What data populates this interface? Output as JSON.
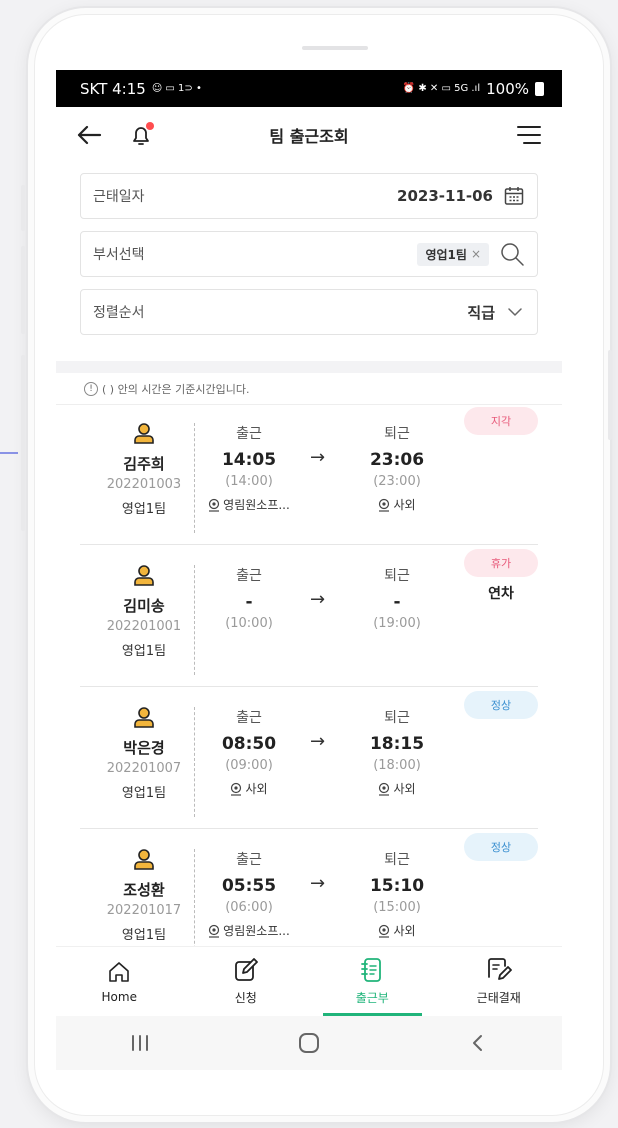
{
  "statusbar": {
    "carrier_time": "SKT 4:15",
    "left_icons": "☺ ▭ 1⊃ •",
    "right_icons": "⏰ ✱ ✕ ▭ 5G .ıl",
    "battery": "100%"
  },
  "header": {
    "title": "팀 출근조회"
  },
  "filters": {
    "date": {
      "label": "근태일자",
      "value": "2023-11-06"
    },
    "dept": {
      "label": "부서선택",
      "chip": "영업1팀",
      "chip_remove": "×"
    },
    "sort": {
      "label": "정렬순서",
      "value": "직급"
    }
  },
  "notice": {
    "icon": "!",
    "text": "( ) 안의 시간은 기준시간입니다."
  },
  "records": [
    {
      "name": "김주희",
      "emp_no": "202201003",
      "dept": "영업1팀",
      "in_label": "출근",
      "in_time": "14:05",
      "in_std": "(14:00)",
      "in_loc": "영림원소프...",
      "out_label": "퇴근",
      "out_time": "23:06",
      "out_std": "(23:00)",
      "out_loc": "사외",
      "status": "지각"
    },
    {
      "name": "김미송",
      "emp_no": "202201001",
      "dept": "영업1팀",
      "in_label": "출근",
      "in_time": "-",
      "in_std": "(10:00)",
      "in_loc": "",
      "out_label": "퇴근",
      "out_time": "-",
      "out_std": "(19:00)",
      "out_loc": "",
      "status": "휴가",
      "leave_type": "연차"
    },
    {
      "name": "박은경",
      "emp_no": "202201007",
      "dept": "영업1팀",
      "in_label": "출근",
      "in_time": "08:50",
      "in_std": "(09:00)",
      "in_loc": "사외",
      "out_label": "퇴근",
      "out_time": "18:15",
      "out_std": "(18:00)",
      "out_loc": "사외",
      "status": "정상"
    },
    {
      "name": "조성환",
      "emp_no": "202201017",
      "dept": "영업1팀",
      "in_label": "출근",
      "in_time": "05:55",
      "in_std": "(06:00)",
      "in_loc": "영림원소프...",
      "out_label": "퇴근",
      "out_time": "15:10",
      "out_std": "(15:00)",
      "out_loc": "사외",
      "status": "정상"
    }
  ],
  "arrow": "→",
  "bottom_nav": [
    {
      "label": "Home",
      "icon": "home-icon"
    },
    {
      "label": "신청",
      "icon": "edit-icon"
    },
    {
      "label": "출근부",
      "icon": "notebook-icon",
      "active": true
    },
    {
      "label": "근태결재",
      "icon": "approval-icon"
    }
  ],
  "colors": {
    "accent": "#20b47a",
    "late": "#e85a7a",
    "normal": "#3a8fd0",
    "person": "#f2b53c"
  }
}
